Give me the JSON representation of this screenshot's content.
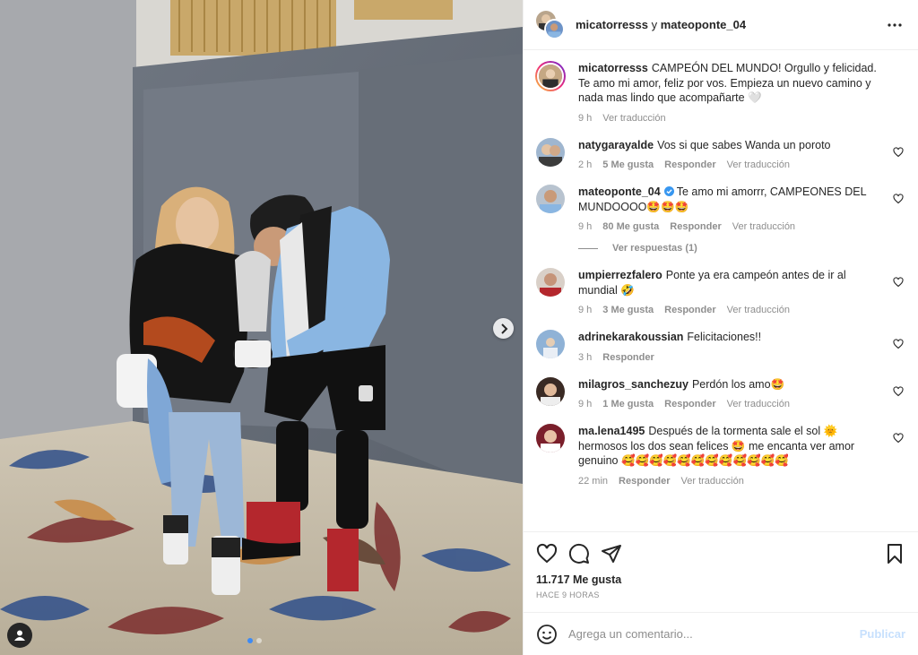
{
  "header": {
    "user1": "micatorresss",
    "conjunction": "y",
    "user2": "mateoponte_04",
    "more_icon": "more-horizontal-icon"
  },
  "caption": {
    "username": "micatorresss",
    "text": "CAMPEÓN DEL MUNDO! Orgullo y felicidad. Te amo mi amor, feliz por vos. Empieza un nuevo camino y nada mas lindo que acompañarte 🤍",
    "time": "9 h",
    "translate": "Ver traducción"
  },
  "comments": [
    {
      "username": "natygarayalde",
      "text": "Vos si que sabes Wanda un poroto",
      "time": "2 h",
      "likes": "5 Me gusta",
      "reply": "Responder",
      "translate": "Ver traducción",
      "verified": false
    },
    {
      "username": "mateoponte_04",
      "text": "Te amo mi amorrr, CAMPEONES DEL MUNDOOOO🤩🤩🤩",
      "time": "9 h",
      "likes": "80 Me gusta",
      "reply": "Responder",
      "translate": "Ver traducción",
      "verified": true
    },
    {
      "username": "umpierrezfalero",
      "text": "Ponte ya era campeón antes de ir al mundial 🤣",
      "time": "9 h",
      "likes": "3 Me gusta",
      "reply": "Responder",
      "translate": "Ver traducción",
      "verified": false
    },
    {
      "username": "adrinekarakoussian",
      "text": "Felicitaciones!!",
      "time": "3 h",
      "likes": "",
      "reply": "Responder",
      "translate": "",
      "verified": false
    },
    {
      "username": "milagros_sanchezuy",
      "text": "Perdón los amo🤩",
      "time": "9 h",
      "likes": "1 Me gusta",
      "reply": "Responder",
      "translate": "Ver traducción",
      "verified": false
    },
    {
      "username": "ma.lena1495",
      "text": "Después de la tormenta sale el sol 🌞 hermosos los dos sean felices 🤩 me encanta ver amor genuino 🥰🥰🥰🥰🥰🥰🥰🥰🥰🥰🥰🥰",
      "time": "22 min",
      "likes": "",
      "reply": "Responder",
      "translate": "Ver traducción",
      "verified": false
    }
  ],
  "view_replies": "Ver respuestas (1)",
  "footer": {
    "likes": "11.717 Me gusta",
    "time_ago": "HACE 9 HORAS",
    "comment_placeholder": "Agrega un comentario...",
    "post_label": "Publicar"
  },
  "colors": {
    "accent_blue": "#0095f6",
    "post_disabled": "#c7e0fd",
    "secondary_text": "#8e8e8e"
  }
}
